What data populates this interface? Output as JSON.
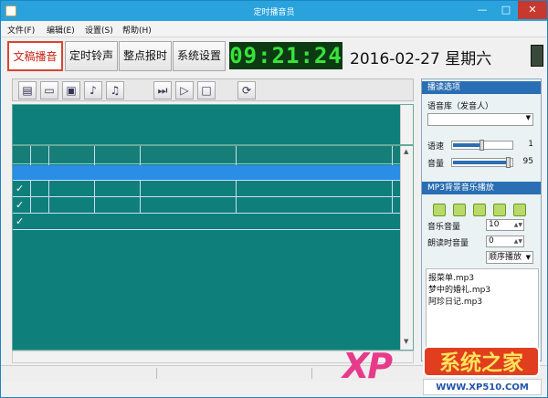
{
  "window": {
    "title": "定时播音员",
    "min": "—",
    "max": "□",
    "close": "✕"
  },
  "menu": [
    "文件(F)",
    "编辑(E)",
    "设置(S)",
    "帮助(H)"
  ],
  "tabs": [
    "文稿播音",
    "定时铃声",
    "整点报时",
    "系统设置"
  ],
  "clock": {
    "time": "09:21:24",
    "date": "2016-02-27  星期六"
  },
  "toolbar": {
    "buttons": [
      {
        "name": "new-doc",
        "glyph": "▤"
      },
      {
        "name": "open-folder",
        "glyph": "▭"
      },
      {
        "name": "save",
        "glyph": "▣"
      },
      {
        "name": "music-note",
        "glyph": "♪"
      },
      {
        "name": "music-note-2",
        "glyph": "♫"
      },
      {
        "name": "step-play",
        "glyph": "⏭"
      },
      {
        "name": "play",
        "glyph": "▷"
      },
      {
        "name": "stop",
        "glyph": "□"
      },
      {
        "name": "refresh",
        "glyph": "⟳"
      }
    ]
  },
  "grid": {
    "rows": [
      {
        "checked": "",
        "selected": true
      },
      {
        "checked": "✓",
        "selected": false
      },
      {
        "checked": "✓",
        "selected": false
      },
      {
        "checked": "✓",
        "selected": false
      }
    ]
  },
  "panel": {
    "broadcast_header": "播读选项",
    "voice_label": "语音库（发音人）",
    "voice_value": "",
    "speed_label": "语速",
    "speed_value": "1",
    "speed_level": 0.5,
    "volume_label": "音量",
    "volume_value": "95",
    "volume_level": 0.95,
    "mp3_header": "MP3背景音乐播放",
    "music_volume_label": "音乐音量",
    "music_volume_value": "10",
    "read_volume_label": "朗读时音量",
    "read_volume_value": "0",
    "play_mode": "顺序播放",
    "mp3_list": [
      "报菜单.mp3",
      "梦中的婚礼.mp3",
      "阿珍日记.mp3"
    ]
  },
  "watermark": {
    "xp": "XP",
    "brand": "系统之家",
    "url": "WWW.XP510.COM"
  },
  "colors": {
    "titlebar": "#2aa3dd",
    "close": "#c7392f",
    "grid": "#0f7f7b",
    "clock_text": "#39e23b",
    "active_tab": "#c82414",
    "panel_header": "#2a6fb3"
  }
}
